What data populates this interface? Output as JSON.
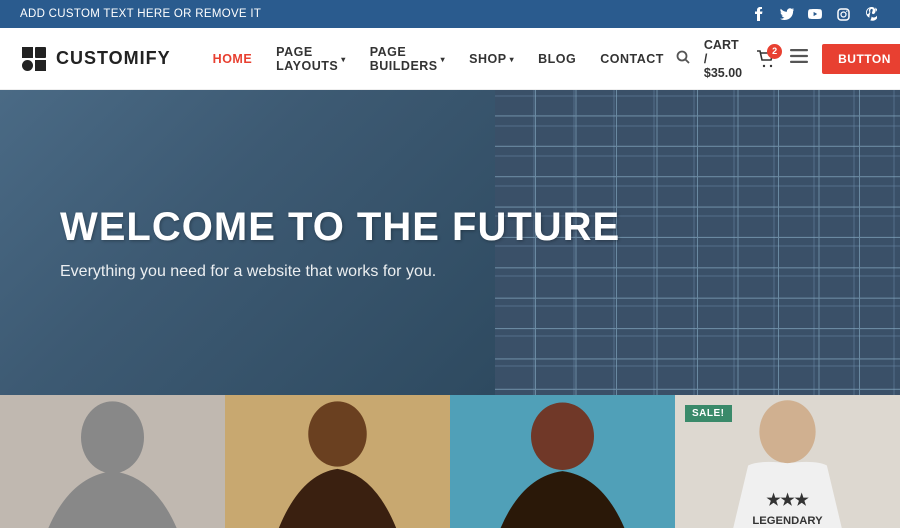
{
  "topBanner": {
    "text": "ADD CUSTOM TEXT HERE OR REMOVE IT",
    "socialIcons": [
      {
        "name": "facebook-icon",
        "symbol": "f"
      },
      {
        "name": "twitter-icon",
        "symbol": "t"
      },
      {
        "name": "youtube-icon",
        "symbol": "▶"
      },
      {
        "name": "instagram-icon",
        "symbol": "◉"
      },
      {
        "name": "pinterest-icon",
        "symbol": "p"
      }
    ]
  },
  "navbar": {
    "logo": {
      "text": "CUSTOMIFY"
    },
    "links": [
      {
        "label": "HOME",
        "hasDropdown": false,
        "active": true
      },
      {
        "label": "PAGE LAYOUTS",
        "hasDropdown": true,
        "active": false
      },
      {
        "label": "PAGE BUILDERS",
        "hasDropdown": true,
        "active": false
      },
      {
        "label": "SHOP",
        "hasDropdown": true,
        "active": false
      },
      {
        "label": "BLOG",
        "hasDropdown": false,
        "active": false
      },
      {
        "label": "CONTACT",
        "hasDropdown": false,
        "active": false
      }
    ],
    "cart": {
      "label": "CART / $35.00",
      "badge": "2"
    },
    "button": {
      "label": "BUTTON"
    }
  },
  "hero": {
    "title": "WELCOME TO THE FUTURE",
    "subtitle": "Everything you need for a website that works for you."
  },
  "products": [
    {
      "id": 1,
      "hasSale": false
    },
    {
      "id": 2,
      "hasSale": false
    },
    {
      "id": 3,
      "hasSale": false
    },
    {
      "id": 4,
      "hasSale": true,
      "saleLabel": "SALE!"
    }
  ]
}
